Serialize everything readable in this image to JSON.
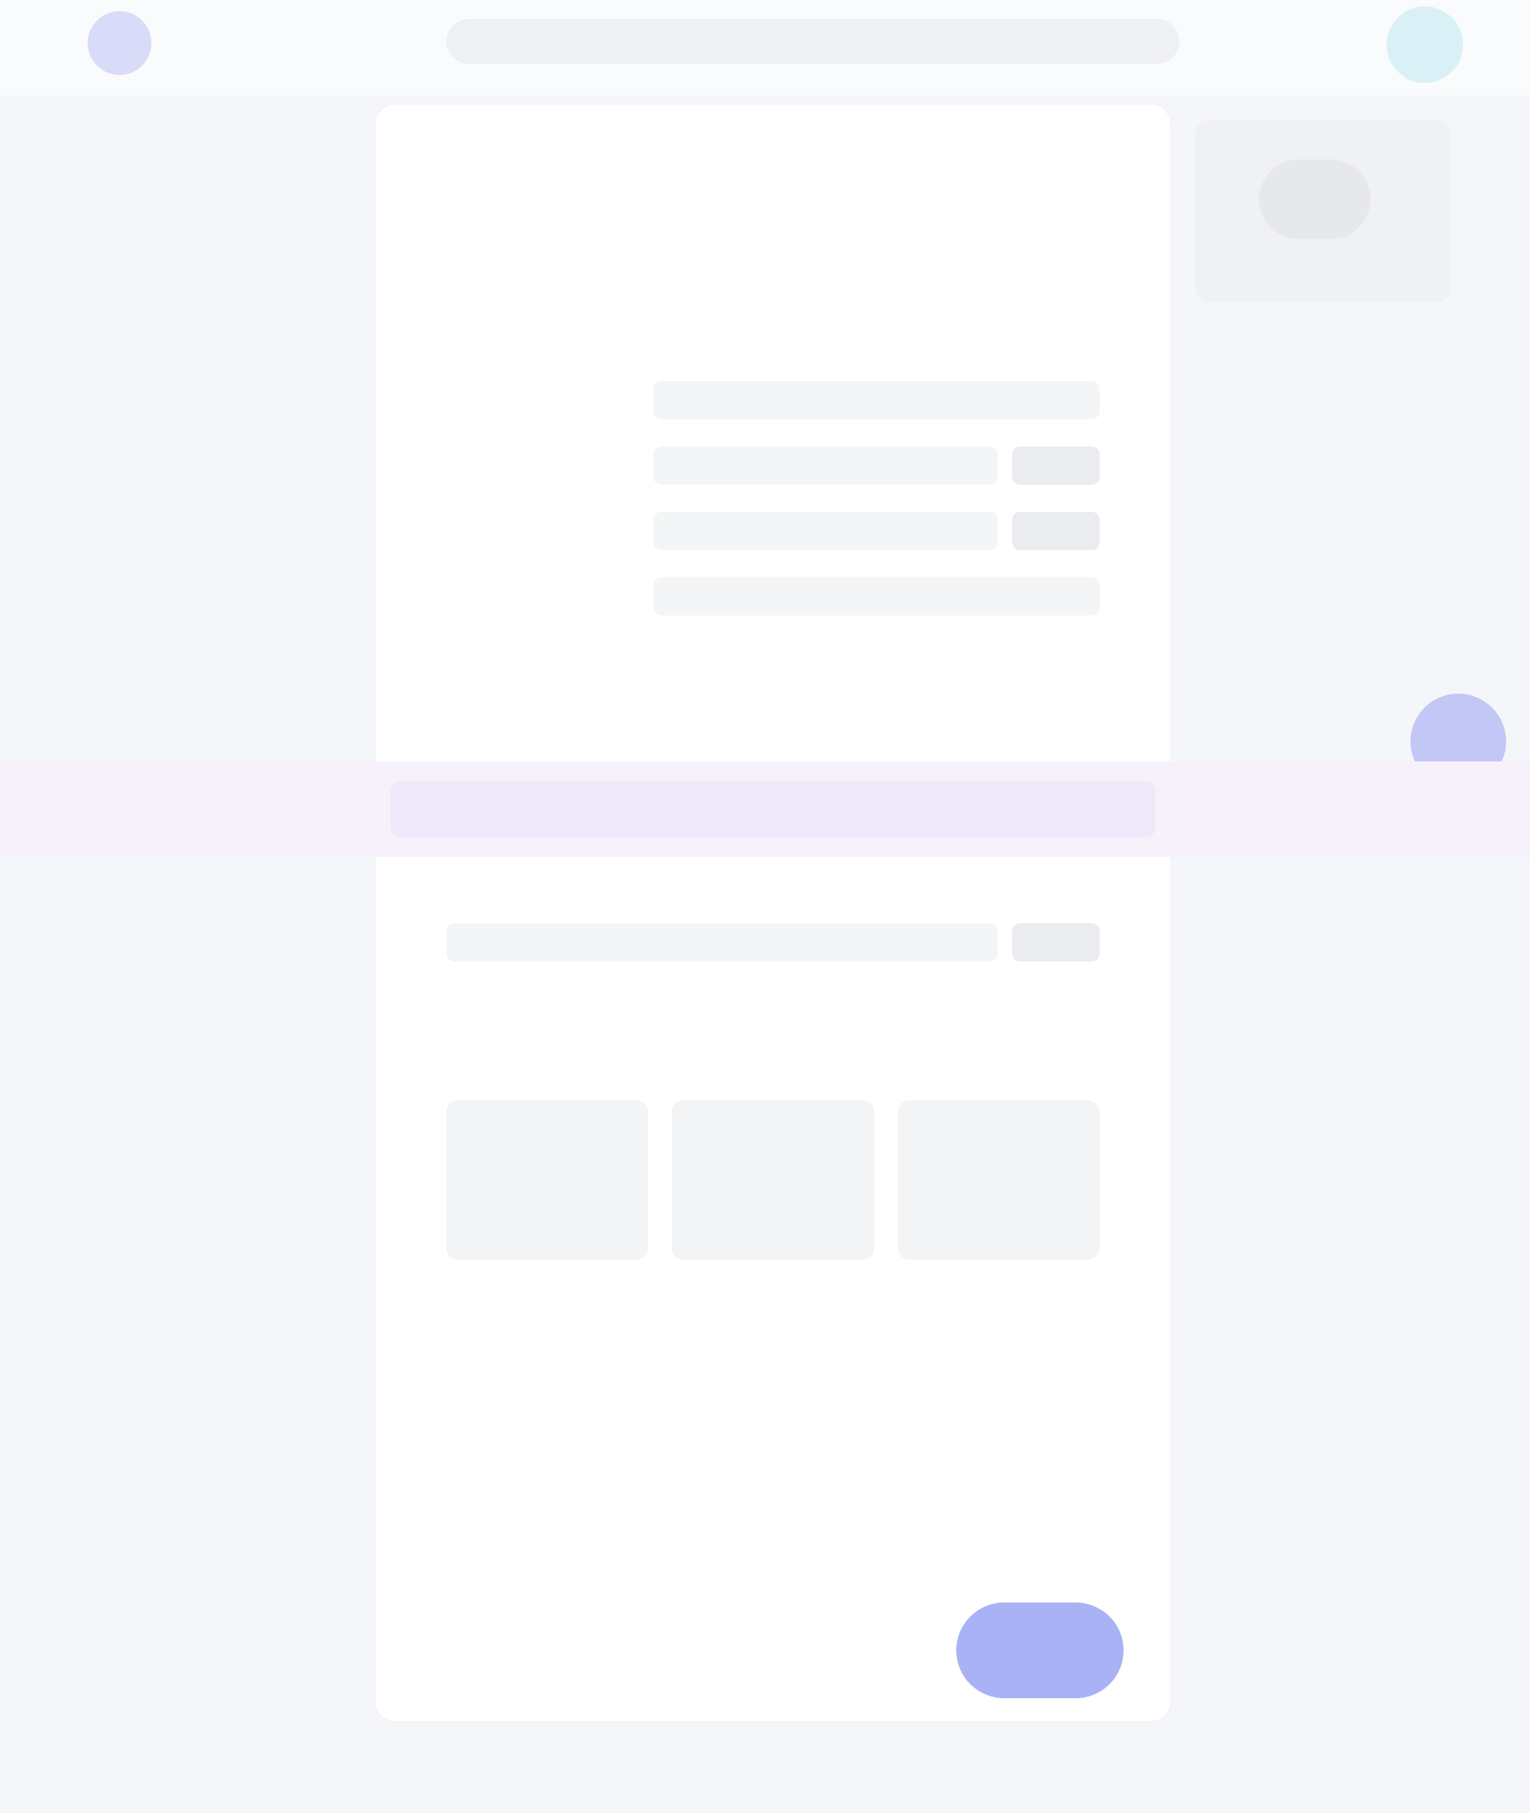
{
  "header": {
    "search_placeholder": ""
  },
  "sidebar": {
    "items": [
      {
        "label": ""
      },
      {
        "label": ""
      }
    ]
  },
  "main": {
    "title": "",
    "subtitle": "",
    "right_label": "",
    "rows": [
      {
        "label": ""
      },
      {
        "label": ""
      },
      {
        "label": ""
      },
      {
        "label": ""
      }
    ],
    "highlight_text": "",
    "footer_note": "",
    "primary_button_label": ""
  },
  "colors": {
    "accent": "#a8b2f5",
    "highlight": "#f6f1fb",
    "avatar": "#d9f1f6"
  }
}
